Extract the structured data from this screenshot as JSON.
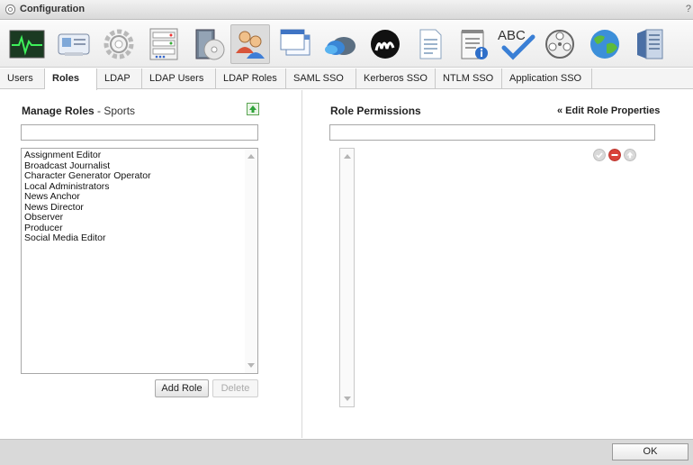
{
  "window": {
    "title": "Configuration",
    "help": "?"
  },
  "toolbar": {
    "icons": [
      "monitor-icon",
      "id-card-icon",
      "gear-icon",
      "server-rack-icon",
      "install-disc-icon",
      "users-icon",
      "windows-icon",
      "cloud-icon",
      "brand-m-icon",
      "document-icon",
      "notepad-info-icon",
      "spellcheck-icon",
      "film-reel-icon",
      "globe-icon",
      "server-icon"
    ],
    "active": "users-icon"
  },
  "tabs": [
    "Users",
    "Roles",
    "LDAP",
    "LDAP Users",
    "LDAP Roles",
    "SAML SSO",
    "Kerberos SSO",
    "NTLM SSO",
    "Application SSO"
  ],
  "active_tab": "Roles",
  "manage_roles": {
    "title": "Manage Roles",
    "subtitle": " - Sports",
    "filter_value": "",
    "roles": [
      "Assignment Editor",
      "Broadcast Journalist",
      "Character Generator Operator",
      "Local Administrators",
      "News Anchor",
      "News Director",
      "Observer",
      "Producer",
      "Social Media Editor"
    ],
    "add_label": "Add Role",
    "delete_label": "Delete"
  },
  "role_permissions": {
    "title": "Role Permissions",
    "edit_link": "« Edit Role Properties",
    "filter_value": ""
  },
  "footer": {
    "ok_label": "OK"
  },
  "colors": {
    "accent_green": "#2fa33a",
    "danger_red": "#d9423a",
    "neutral_grey": "#c9c9c9"
  }
}
